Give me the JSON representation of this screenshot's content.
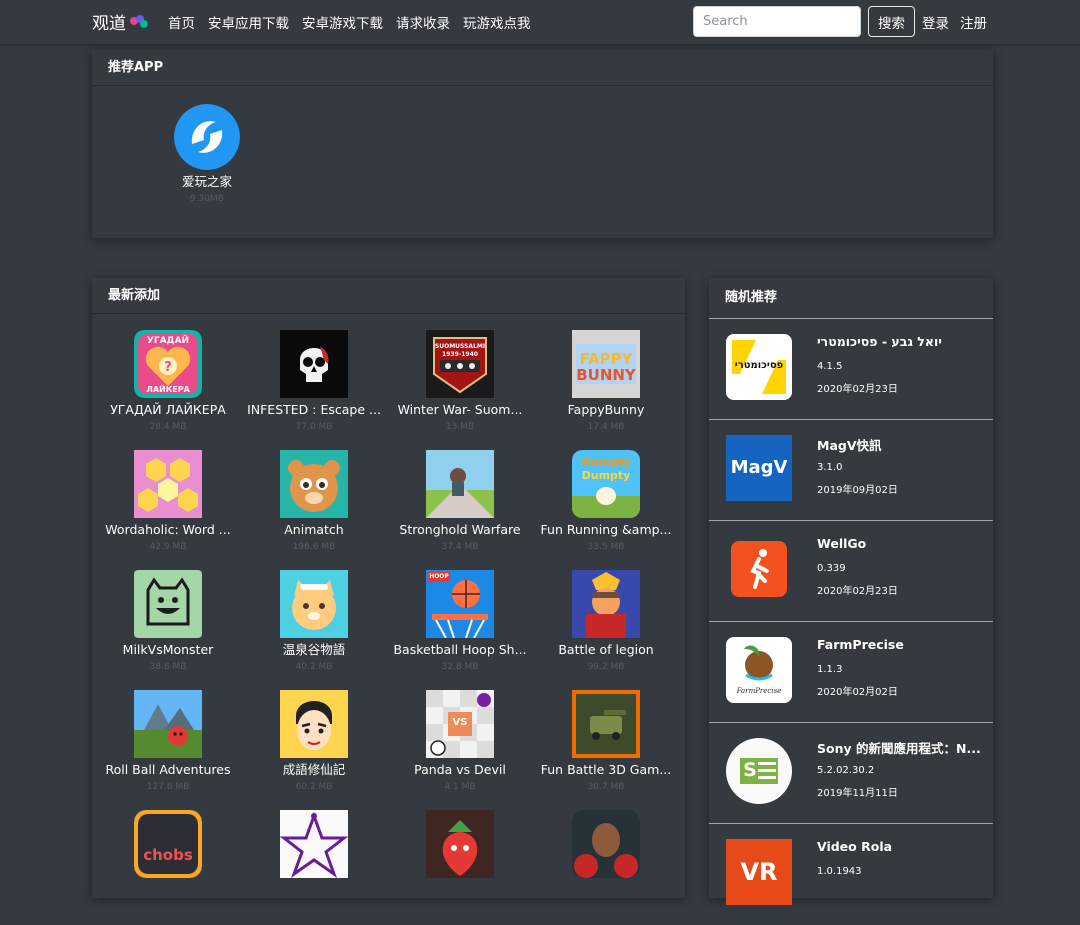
{
  "navbar": {
    "brand": "观道",
    "links": [
      "首页",
      "安卓应用下载",
      "安卓游戏下载",
      "请求收录",
      "玩游戏点我"
    ],
    "search_placeholder": "Search",
    "search_button": "搜索",
    "login": "登录",
    "register": "注册"
  },
  "recommended": {
    "title": "推荐APP",
    "apps": [
      {
        "name": "爱玩之家",
        "size": "9.30MB",
        "icon": "dolphins-icon"
      }
    ]
  },
  "latest": {
    "title": "最新添加",
    "apps": [
      {
        "name": "УГАДАЙ ЛАЙКЕРА",
        "size": "28.4 MB",
        "icon": "ugaday-icon"
      },
      {
        "name": "INFESTED : Escape ...",
        "size": "77.0 MB",
        "icon": "skull-icon"
      },
      {
        "name": "Winter War- Suom...",
        "size": "13 MB",
        "icon": "winter-war-icon"
      },
      {
        "name": "FappyBunny",
        "size": "17.4 MB",
        "icon": "fappy-bunny-icon"
      },
      {
        "name": "Wordaholic: Word ...",
        "size": "42.9 MB",
        "icon": "wordaholic-icon"
      },
      {
        "name": "Animatch",
        "size": "196.6 MB",
        "icon": "tiger-cub-icon"
      },
      {
        "name": "Stronghold Warfare",
        "size": "37.4 MB",
        "icon": "stronghold-icon"
      },
      {
        "name": "Fun Running &amp...",
        "size": "33.5 MB",
        "icon": "humpty-dumpty-icon"
      },
      {
        "name": "MilkVsMonster",
        "size": "38.8 MB",
        "icon": "monster-icon"
      },
      {
        "name": "温泉谷物語",
        "size": "40.2 MB",
        "icon": "cat-icon"
      },
      {
        "name": "Basketball Hoop Sh...",
        "size": "32.8 MB",
        "icon": "basketball-icon"
      },
      {
        "name": "Battle of legion",
        "size": "99.2 MB",
        "icon": "legion-icon"
      },
      {
        "name": "Roll Ball Adventures",
        "size": "127.6 MB",
        "icon": "roll-ball-icon"
      },
      {
        "name": "成語修仙記",
        "size": "60.2 MB",
        "icon": "immortal-icon"
      },
      {
        "name": "Panda vs Devil",
        "size": "4.1 MB",
        "icon": "panda-devil-icon"
      },
      {
        "name": "Fun Battle 3D Gam...",
        "size": "30.7 MB",
        "icon": "battle-3d-icon"
      },
      {
        "name": "",
        "size": "",
        "icon": "chobs-icon"
      },
      {
        "name": "",
        "size": "",
        "icon": "star-drawing-icon"
      },
      {
        "name": "",
        "size": "",
        "icon": "strawberry-icon"
      },
      {
        "name": "",
        "size": "",
        "icon": "boxer-icon"
      }
    ]
  },
  "random": {
    "title": "随机推荐",
    "items": [
      {
        "name": "יואל גבע - פסיכומטרי",
        "version": "4.1.5",
        "date": "2020年02月23日",
        "icon": "psychometric-icon"
      },
      {
        "name": "MagV快訊",
        "version": "3.1.0",
        "date": "2019年09月02日",
        "icon": "magv-icon"
      },
      {
        "name": "WellGo",
        "version": "0.339",
        "date": "2020年02月23日",
        "icon": "wellgo-icon"
      },
      {
        "name": "FarmPrecise",
        "version": "1.1.3",
        "date": "2020年02月02日",
        "icon": "farmprecise-icon"
      },
      {
        "name": "Sony 的新聞應用程式：N...",
        "version": "5.2.02.30.2",
        "date": "2019年11月11日",
        "icon": "sony-news-icon"
      },
      {
        "name": "Video Rola",
        "version": "1.0.1943",
        "date": "",
        "icon": "video-rola-icon"
      }
    ]
  },
  "icon_text": {
    "ugaday_top": "УГАДАЙ",
    "ugaday_bottom": "ЛАЙКЕРА",
    "winter_war": "SUOMUSSALMI",
    "winter_years": "1939-1940",
    "fappy": "FAPPY",
    "bunny": "BUNNY",
    "humpty": "Humpty",
    "dumpty": "Dumpty",
    "panda_vs": "VS",
    "chobs": "chobs",
    "psychometric": "פסיכומטרי",
    "magv": "MagV",
    "farmprecise": "FarmPrecise",
    "video_rola": "VR",
    "stronghold_sign": "HOOP",
    "sony_letter": "S"
  }
}
